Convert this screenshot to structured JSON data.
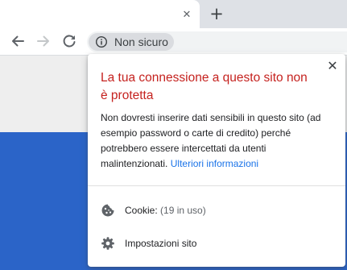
{
  "browser": {
    "tab_close_glyph": "✕",
    "new_tab_glyph": "+",
    "omnibox": {
      "security_chip_label": "Non sicuro"
    }
  },
  "popup": {
    "close_glyph": "✕",
    "title": "La tua connessione a questo sito non è protetta",
    "body": "Non dovresti inserire dati sensibili in questo sito (ad esempio password o carte di credito) perché potrebbero essere intercettati da utenti malintenzionati.",
    "link": "Ulteriori informazioni",
    "cookies": {
      "label": "Cookie:",
      "count": "(19 in uso)"
    },
    "site_settings": {
      "label": "Impostazioni sito"
    }
  },
  "colors": {
    "warning_title": "#c5221f",
    "link": "#1a73e8",
    "page_blue": "#2b64c8",
    "tabstrip": "#dee1e6"
  },
  "icons": {
    "back": "arrow-left-icon",
    "forward": "arrow-right-icon",
    "reload": "reload-icon",
    "security": "info-icon",
    "cookie": "cookie-icon",
    "settings": "gear-icon"
  }
}
